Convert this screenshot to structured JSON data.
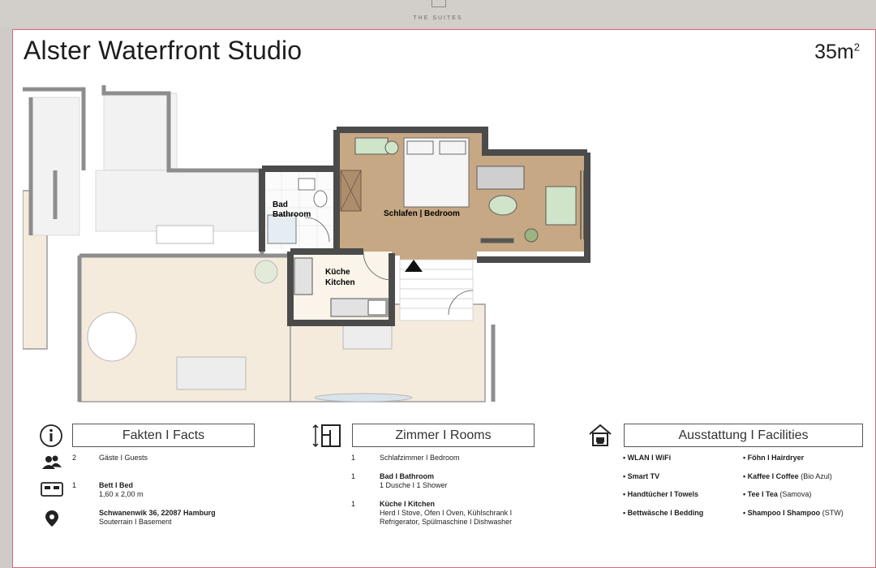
{
  "brand": {
    "name": "THE SUITES"
  },
  "header": {
    "title": "Alster Waterfront Studio",
    "area_value": "35m",
    "area_unit": "2"
  },
  "plan_labels": {
    "bath": [
      "Bad",
      "Bathroom"
    ],
    "bedroom": "Schlafen | Bedroom",
    "kitchen": [
      "Küche",
      "Kitchen"
    ]
  },
  "facts": {
    "title": "Fakten I Facts",
    "items": [
      {
        "icon": "guests-icon",
        "num": "2",
        "label": "Gäste I Guests",
        "sub": ""
      },
      {
        "icon": "bed-icon",
        "num": "1",
        "label": "Bett I Bed",
        "sub": "1,60 x 2,00 m"
      },
      {
        "icon": "location-pin-icon",
        "num": "",
        "label": "Schwanenwik 36, 22087 Hamburg",
        "sub": "Souterrain I Basement"
      }
    ]
  },
  "rooms": {
    "title": "Zimmer I Rooms",
    "items": [
      {
        "num": "1",
        "label": "Schlafzimmer I Bedroom",
        "sub": ""
      },
      {
        "num": "1",
        "label": "Bad I Bathroom",
        "sub": "1 Dusche I 1 Shower"
      },
      {
        "num": "1",
        "label": "Küche I Kitchen",
        "sub": "Herd I Stove, Ofen I Oven, Kühlschrank I",
        "sub2": "Refrigerator, Spülmaschine I Dishwasher"
      }
    ]
  },
  "facilities": {
    "title": "Ausstattung I Facilities",
    "left": [
      "WLAN I WiFi",
      "Smart TV",
      "Handtücher I Towels",
      "Bettwäsche I Bedding"
    ],
    "right": [
      {
        "label": "Föhn I Hairdryer",
        "note": ""
      },
      {
        "label": "Kaffee I Coffee",
        "note": "(Bio Azul)"
      },
      {
        "label": "Tee I Tea",
        "note": "(Samova)"
      },
      {
        "label": "Shampoo I Shampoo",
        "note": "(STW)"
      }
    ],
    "bullet": "•"
  },
  "colors": {
    "accent_border": "#d66a7f",
    "floor_wood": "#c7a884",
    "floor_beige": "#f4e7d6",
    "wall": "#4b4b4b"
  }
}
